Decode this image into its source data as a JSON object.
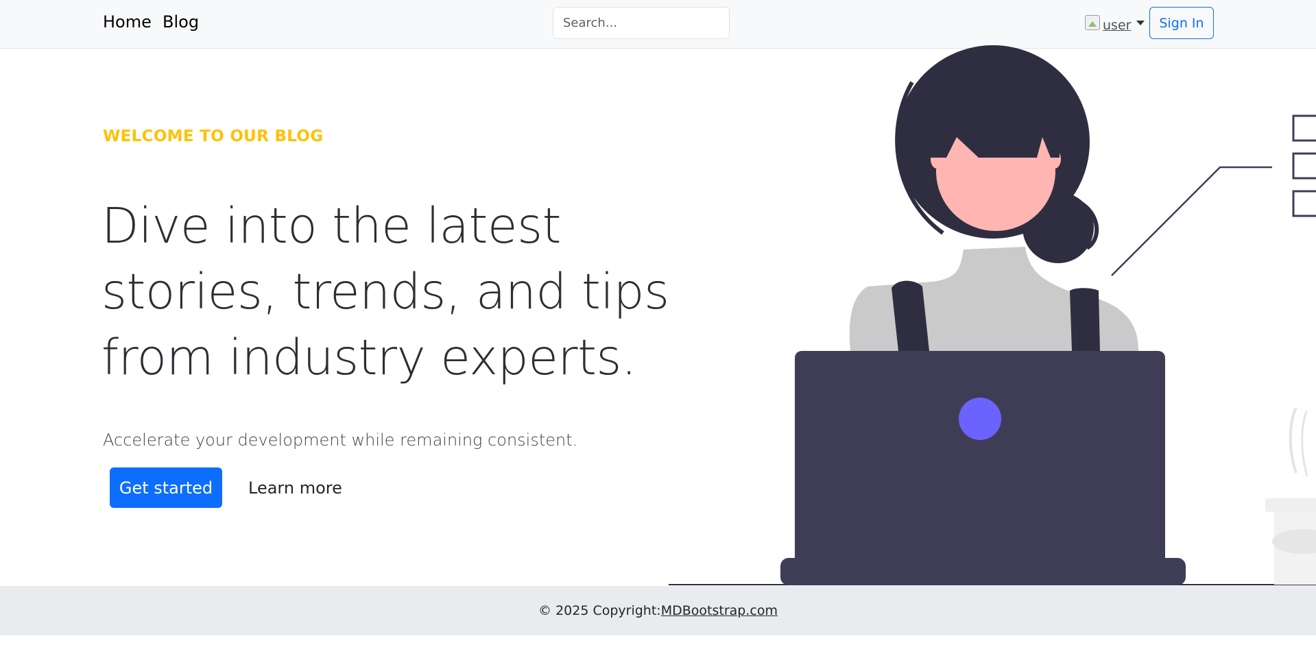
{
  "navbar": {
    "links": [
      "Home",
      "Blog"
    ],
    "search_placeholder": "Search...",
    "user_image_alt": "user",
    "signin_label": "Sign In"
  },
  "hero": {
    "eyebrow": "WELCOME TO OUR BLOG",
    "headline_lines": [
      "Dive into the latest",
      "stories, trends, and tips",
      "from industry experts."
    ],
    "lead": "Accelerate your development while remaining consistent.",
    "primary_button": "Get started",
    "secondary_button": "Learn more"
  },
  "footer": {
    "copyright": "© 2025 Copyright:",
    "link_text": "MDBootstrap.com"
  },
  "colors": {
    "accent": "#0d6efd",
    "eyebrow": "#ffc107",
    "laptop": "#3f3d56",
    "hair": "#2f2e41",
    "skin": "#ffb6b3",
    "shirt": "#cacaca",
    "logo_dot": "#6c63ff"
  }
}
